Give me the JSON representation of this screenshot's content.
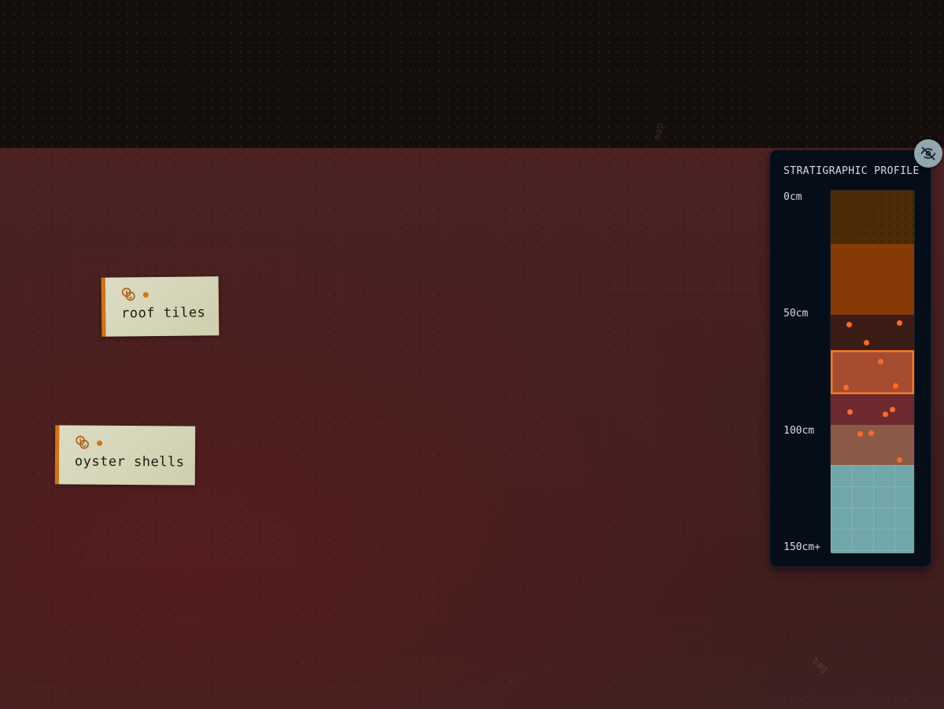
{
  "panel": {
    "title": "STRATIGRAPHIC PROFILE",
    "depth_labels": [
      "0cm",
      "50cm",
      "100cm",
      "150cm+"
    ],
    "layers": [
      {
        "color": "#4d2a06"
      },
      {
        "color": "#873a06"
      },
      {
        "color": "#3c1d16"
      },
      {
        "color": "#a64c30",
        "selected": true
      },
      {
        "color": "#6c2a2e"
      },
      {
        "color": "#8b5a47"
      },
      {
        "color": "#72a7aa"
      }
    ],
    "toggle_icon": "eye-off-icon"
  },
  "tags": [
    {
      "label": "roof tiles",
      "icon": "coins-icon"
    },
    {
      "label": "oyster shells",
      "icon": "coins-icon"
    }
  ],
  "faint_labels": [
    "map",
    "bag"
  ],
  "colors": {
    "accent": "#d0750f",
    "highlight": "#ff7a1e",
    "panel_bg": "#050d18",
    "canvas": "#4a2121"
  }
}
